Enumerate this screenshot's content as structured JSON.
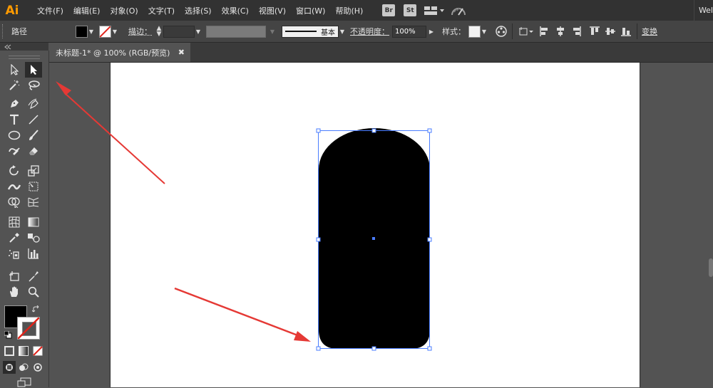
{
  "app": {
    "logo": "Ai"
  },
  "menu": {
    "items": [
      "文件(F)",
      "编辑(E)",
      "对象(O)",
      "文字(T)",
      "选择(S)",
      "效果(C)",
      "视图(V)",
      "窗口(W)",
      "帮助(H)"
    ],
    "bridge": "Br",
    "stock": "St",
    "workspace": "Wel"
  },
  "control": {
    "selection_type": "路径",
    "stroke_label": "描边：",
    "brush_label": "基本",
    "opacity_label": "不透明度：",
    "opacity_value": "100%",
    "style_label": "样式：",
    "transform_label": "变换"
  },
  "document": {
    "tab_title": "未标题-1* @ 100% (RGB/预览)",
    "close": "✖"
  },
  "colors": {
    "fill": "#000000",
    "stroke": "none",
    "accent_selection": "#4a7dff",
    "arrow": "#e53935"
  }
}
